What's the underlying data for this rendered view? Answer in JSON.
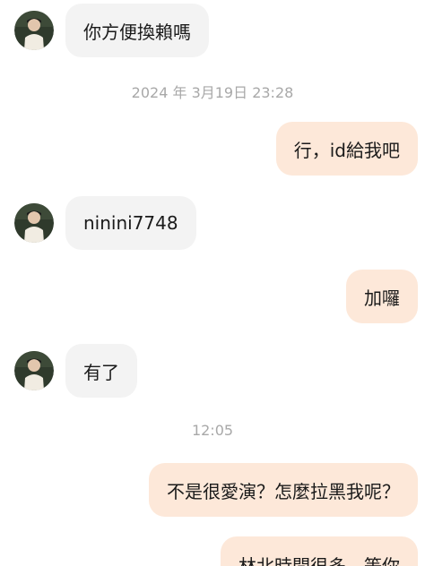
{
  "messages": [
    {
      "type": "incoming",
      "text": "你方便換賴嗎"
    },
    {
      "type": "timestamp",
      "text": "2024 年 3月19日 23:28"
    },
    {
      "type": "outgoing",
      "text": "行，id給我吧"
    },
    {
      "type": "incoming",
      "text": "ninini7748"
    },
    {
      "type": "outgoing",
      "text": "加囉"
    },
    {
      "type": "incoming",
      "text": "有了"
    },
    {
      "type": "timestamp",
      "text": "12:05"
    },
    {
      "type": "outgoing",
      "text": "不是很愛演？怎麼拉黑我呢？"
    },
    {
      "type": "outgoing",
      "text": "林北時間很多，等你"
    }
  ],
  "colors": {
    "incoming_bubble": "#f3f3f3",
    "outgoing_bubble": "#fde8d9",
    "timestamp_text": "#a8a8a8"
  },
  "icons": {
    "avatar": "user-avatar-photo"
  }
}
